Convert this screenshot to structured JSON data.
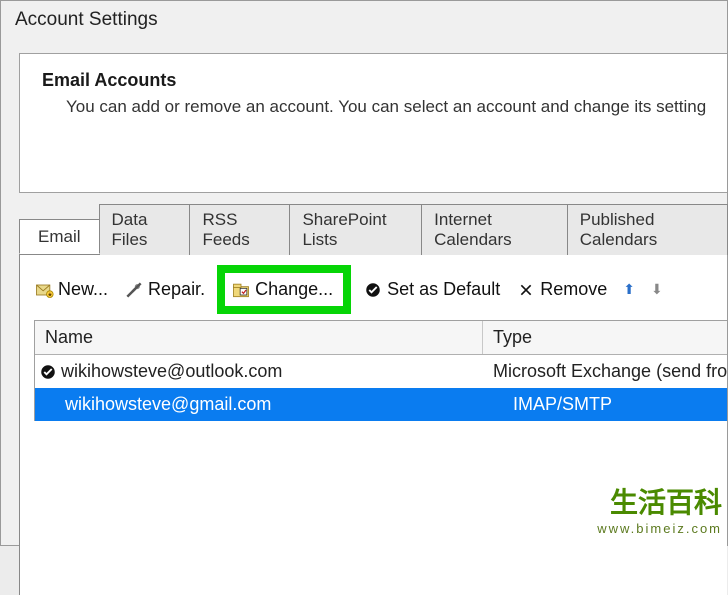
{
  "window": {
    "title": "Account Settings"
  },
  "panel": {
    "heading": "Email Accounts",
    "description": "You can add or remove an account. You can select an account and change its setting"
  },
  "tabs": {
    "items": [
      {
        "label": "Email",
        "active": true
      },
      {
        "label": "Data Files",
        "active": false
      },
      {
        "label": "RSS Feeds",
        "active": false
      },
      {
        "label": "SharePoint Lists",
        "active": false
      },
      {
        "label": "Internet Calendars",
        "active": false
      },
      {
        "label": "Published Calendars",
        "active": false
      }
    ]
  },
  "toolbar": {
    "new_label": "New...",
    "repair_label": "Repair.",
    "change_label": "Change...",
    "default_label": "Set as Default",
    "remove_label": "Remove"
  },
  "table": {
    "headers": {
      "name": "Name",
      "type": "Type"
    },
    "rows": [
      {
        "default": true,
        "selected": false,
        "name": "wikihowsteve@outlook.com",
        "type": "Microsoft Exchange (send from t"
      },
      {
        "default": false,
        "selected": true,
        "name": "wikihowsteve@gmail.com",
        "type": "IMAP/SMTP"
      }
    ]
  },
  "watermark": {
    "chars": "生活百科",
    "url": "www.bimeiz.com"
  }
}
